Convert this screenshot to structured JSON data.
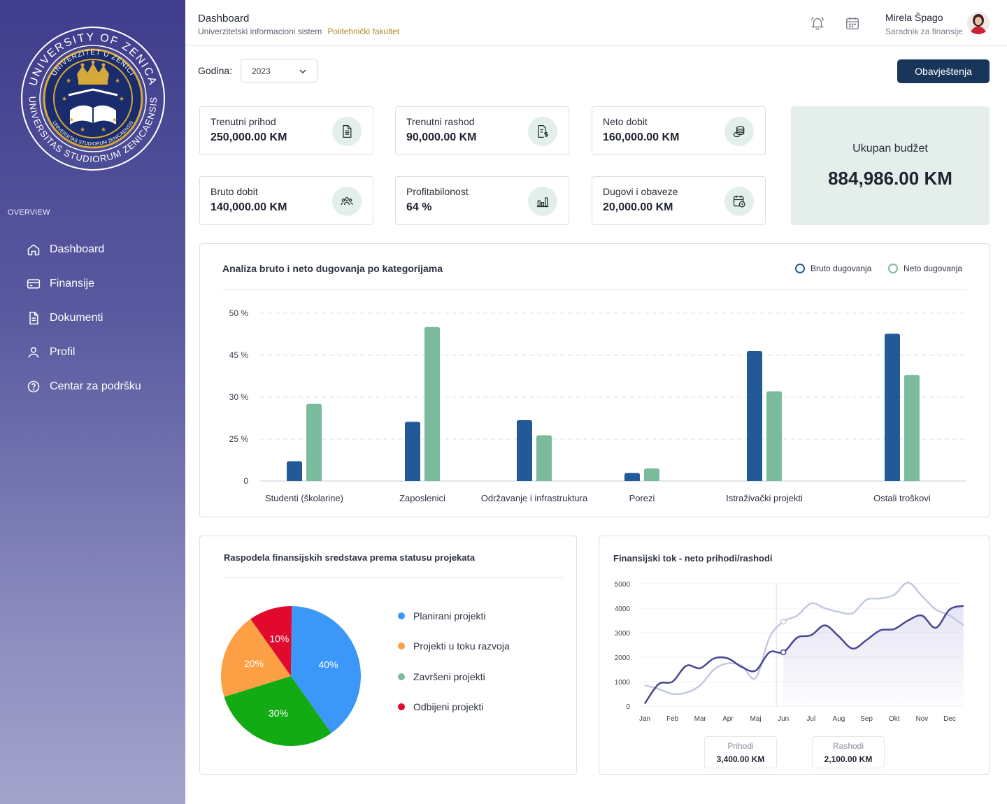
{
  "sidebar": {
    "logo_text": {
      "outer_top": "UNIVERSITY OF ZENICA",
      "outer_bottom": "UNIVERSITAS STUDIORUM ZENICAENSIS",
      "inner_top": "UNIVERZITET U ZENICI",
      "inner_bottom": "UNIVERSITAS STUDIORUM ZENICAENSIS"
    },
    "section_label": "OVERVIEW",
    "items": [
      {
        "label": "Dashboard",
        "icon": "home-icon"
      },
      {
        "label": "Finansije",
        "icon": "credit-card-icon"
      },
      {
        "label": "Dokumenti",
        "icon": "document-icon"
      },
      {
        "label": "Profil",
        "icon": "user-icon"
      },
      {
        "label": "Centar za podršku",
        "icon": "help-circle-icon"
      }
    ]
  },
  "header": {
    "title": "Dashboard",
    "subtitle": "Univerzitetski informacioni sistem",
    "faculty": "Politehnički fakultet",
    "user_name": "Mirela Špago",
    "user_role": "Saradnik za finansije"
  },
  "filters": {
    "year_label": "Godina:",
    "year_value": "2023",
    "notifications_button": "Obavještenja"
  },
  "stats": [
    {
      "label": "Trenutni prihod",
      "value": "250,000.00 KM",
      "icon": "document-icon"
    },
    {
      "label": "Trenutni rashod",
      "value": "90,000.00 KM",
      "icon": "invoice-dollar-icon"
    },
    {
      "label": "Neto dobit",
      "value": "160,000.00 KM",
      "icon": "coins-icon"
    },
    {
      "label": "Bruto dobit",
      "value": "140,000.00 KM",
      "icon": "team-icon"
    },
    {
      "label": "Profitabilonost",
      "value": "64 %",
      "icon": "bar-chart-icon"
    },
    {
      "label": "Dugovi i obaveze",
      "value": "20,000.00 KM",
      "icon": "calendar-clock-icon"
    }
  ],
  "budget": {
    "label": "Ukupan budžet",
    "value": "884,986.00 KM"
  },
  "colors": {
    "bruto": "#215a96",
    "neto": "#7bbb9d",
    "line_prihodi": "#4a4690",
    "line_rashodi": "#c3c9de",
    "pie": [
      "#3b97f8",
      "#13ab13",
      "#fd9f45",
      "#e2092e"
    ]
  },
  "chart_data": [
    {
      "type": "bar",
      "title": "Analiza bruto i neto dugovanja po kategorijama",
      "categories": [
        "Studenti (školarine)",
        "Zaposlenici",
        "Održavanje i infrastruktura",
        "Porezi",
        "Istraživački projekti",
        "Ostali troškovi"
      ],
      "y_ticks": [
        "50 %",
        "45 %",
        "30 %",
        "25 %",
        "0"
      ],
      "ylim": [
        0,
        4
      ],
      "grid": true,
      "legend_position": "top-right",
      "series": [
        {
          "name": "Bruto dugovanja",
          "values": [
            0.47,
            1.41,
            1.45,
            0.19,
            3.1,
            3.51
          ]
        },
        {
          "name": "Neto dugovanja",
          "values": [
            1.84,
            3.67,
            1.09,
            0.3,
            2.14,
            2.53
          ]
        }
      ]
    },
    {
      "type": "pie",
      "title": "Raspodela finansijskih sredstava prema statusu projekata",
      "slices": [
        {
          "label": "40%",
          "value": 40,
          "color": "#3b97f8"
        },
        {
          "label": "30%",
          "value": 30,
          "color": "#13ab13"
        },
        {
          "label": "20%",
          "value": 20,
          "color": "#fd9f45"
        },
        {
          "label": "10%",
          "value": 10,
          "color": "#e2092e"
        }
      ],
      "legend": [
        {
          "label": "Planirani projekti",
          "color": "#3b97f8"
        },
        {
          "label": "Projekti u toku razvoja",
          "color": "#fd9f45"
        },
        {
          "label": "Završeni projekti",
          "color": "#7bbb9d"
        },
        {
          "label": "Odbijeni projekti",
          "color": "#e2092e"
        }
      ]
    },
    {
      "type": "line",
      "title": "Finansijski tok - neto prihodi/rashodi",
      "categories": [
        "Jan",
        "Feb",
        "Mar",
        "Apr",
        "Maj",
        "Jun",
        "Jul",
        "Aug",
        "Sep",
        "Okt",
        "Nov",
        "Dec"
      ],
      "y_ticks": [
        0,
        1000,
        2000,
        3000,
        4000,
        5000
      ],
      "ylim": [
        0,
        5000
      ],
      "x_steps": [
        0,
        0.5,
        1,
        1.5,
        2,
        2.5,
        3,
        3.5,
        4,
        4.5,
        5,
        5.5,
        6,
        6.5,
        7,
        7.5,
        8,
        8.5,
        9,
        9.5,
        10,
        10.5,
        11,
        11.5
      ],
      "series": [
        {
          "name": "Prihodi",
          "values": [
            100,
            900,
            1000,
            1650,
            1550,
            1950,
            1950,
            1600,
            1450,
            2200,
            2200,
            2800,
            2900,
            3300,
            2850,
            2350,
            2700,
            3100,
            3150,
            3500,
            3700,
            3200,
            3950,
            4100
          ]
        },
        {
          "name": "Rashodi",
          "values": [
            850,
            700,
            500,
            550,
            850,
            1500,
            1750,
            1650,
            1150,
            2800,
            3450,
            3700,
            4200,
            4000,
            3850,
            3800,
            4350,
            4400,
            4550,
            5050,
            4500,
            3950,
            3700,
            3300
          ]
        }
      ],
      "summary": [
        {
          "label": "Prihodi",
          "value": "3,400.00 KM"
        },
        {
          "label": "Rashodi",
          "value": "2,100.00 KM"
        }
      ]
    }
  ]
}
